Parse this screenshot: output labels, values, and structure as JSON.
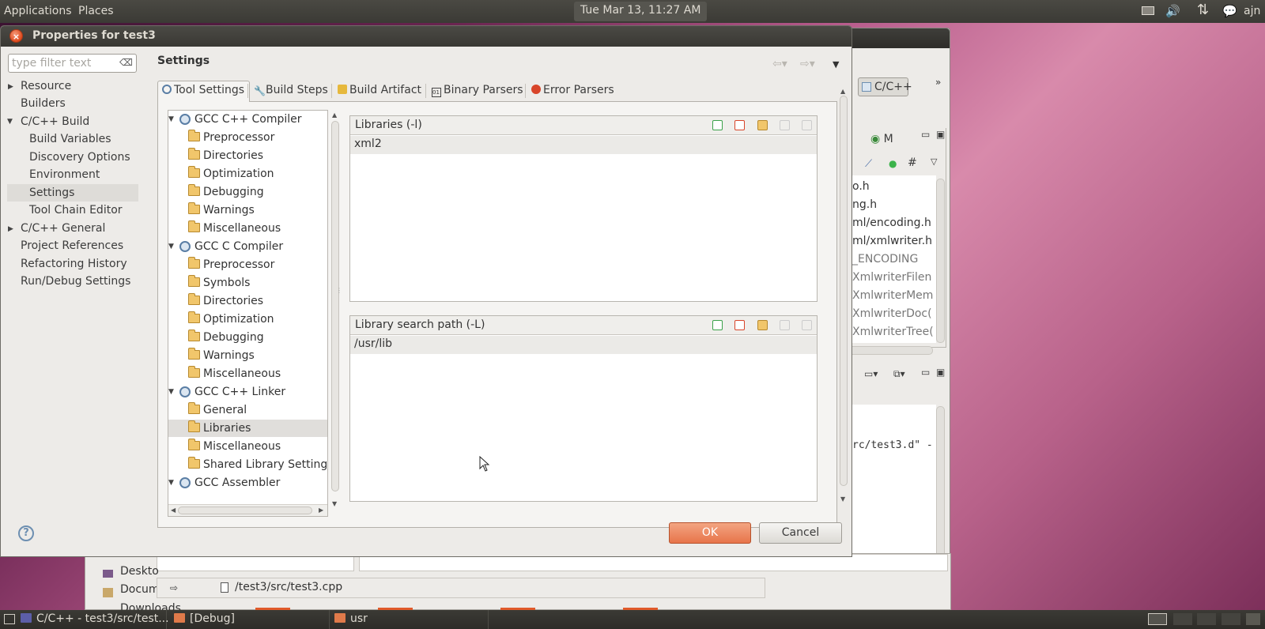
{
  "top_panel": {
    "applications": "Applications",
    "places": "Places",
    "clock": "Tue Mar 13, 11:27 AM",
    "user": "ajn"
  },
  "background_window": {
    "perspective_label": "C/C++",
    "outline_tab": "M",
    "outline_items": [
      "o.h",
      "ng.h",
      "ml/encoding.h",
      "ml/xmlwriter.h",
      "_ENCODING",
      "XmlwriterFilen",
      "XmlwriterMem",
      "XmlwriterDoc(",
      "XmlwriterTree("
    ],
    "console_line": "rc/test3.d\" -",
    "lower_places": [
      "Deskto",
      "Docum",
      "Downloads"
    ],
    "editor_path": "/test3/src/test3.cpp"
  },
  "dialog": {
    "title": "Properties for test3",
    "filter_placeholder": "type filter text",
    "nav": [
      "Resource",
      "Builders",
      "C/C++ Build",
      "Build Variables",
      "Discovery Options",
      "Environment",
      "Settings",
      "Tool Chain Editor",
      "C/C++ General",
      "Project References",
      "Refactoring History",
      "Run/Debug Settings"
    ],
    "settings_title": "Settings",
    "tabs": [
      "Tool Settings",
      "Build Steps",
      "Build Artifact",
      "Binary Parsers",
      "Error Parsers"
    ],
    "tool_tree": [
      "GCC C++ Compiler",
      "Preprocessor",
      "Directories",
      "Optimization",
      "Debugging",
      "Warnings",
      "Miscellaneous",
      "GCC C Compiler",
      "Preprocessor",
      "Symbols",
      "Directories",
      "Optimization",
      "Debugging",
      "Warnings",
      "Miscellaneous",
      "GCC C++ Linker",
      "General",
      "Libraries",
      "Miscellaneous",
      "Shared Library Settings",
      "GCC Assembler"
    ],
    "libraries": {
      "title": "Libraries (-l)",
      "items": [
        "xml2"
      ]
    },
    "library_paths": {
      "title": "Library search path (-L)",
      "items": [
        "/usr/lib"
      ]
    },
    "help": "?",
    "ok": "OK",
    "cancel": "Cancel"
  },
  "taskbar": {
    "tasks": [
      "C/C++ - test3/src/test...",
      "[Debug]",
      "usr"
    ]
  },
  "colors": {
    "ok_button": "#e7744a",
    "panel_dark": "#3b3a35",
    "selection": "#dedcd8"
  }
}
